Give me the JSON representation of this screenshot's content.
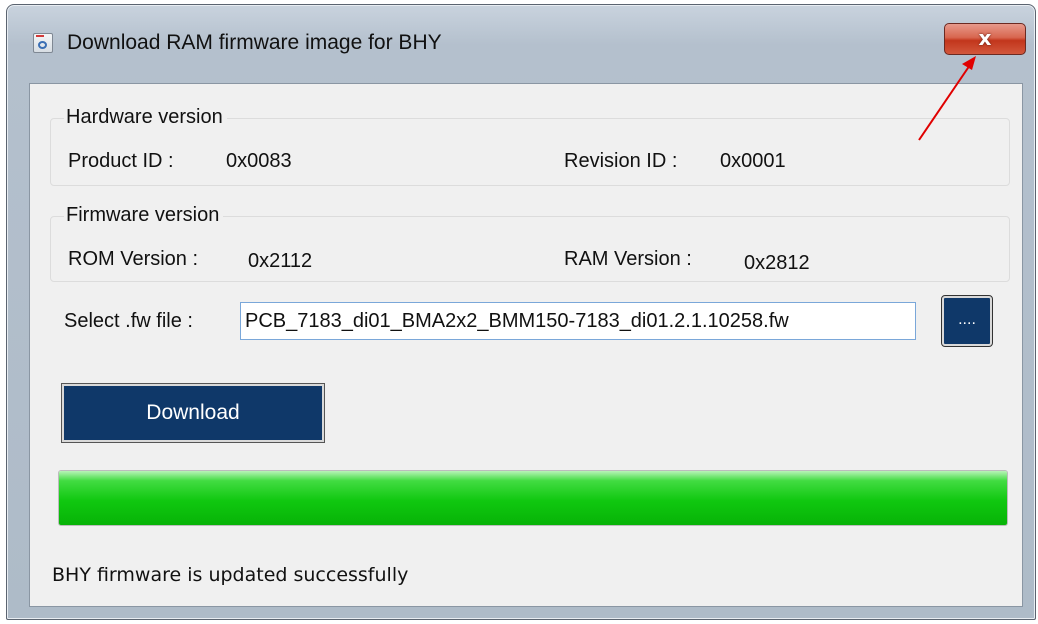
{
  "window": {
    "title": "Download RAM firmware image for BHY",
    "close_label": "x"
  },
  "hardware": {
    "legend": "Hardware version",
    "product_id_label": "Product ID :",
    "product_id_value": "0x0083",
    "revision_id_label": "Revision ID :",
    "revision_id_value": "0x0001"
  },
  "firmware": {
    "legend": "Firmware version",
    "rom_label": "ROM Version :",
    "rom_value": "0x2112",
    "ram_label": "RAM Version :",
    "ram_value": "0x2812"
  },
  "file": {
    "label": "Select .fw file :",
    "value": "PCB_7183_di01_BMA2x2_BMM150-7183_di01.2.1.10258.fw",
    "browse_label": "...."
  },
  "download": {
    "label": "Download"
  },
  "progress": {
    "percent": 100
  },
  "status": {
    "text": "BHY firmware is updated successfully"
  },
  "colors": {
    "button_bg": "#0f3869",
    "progress_green": "#10c810",
    "annotation_arrow": "#e00000"
  }
}
